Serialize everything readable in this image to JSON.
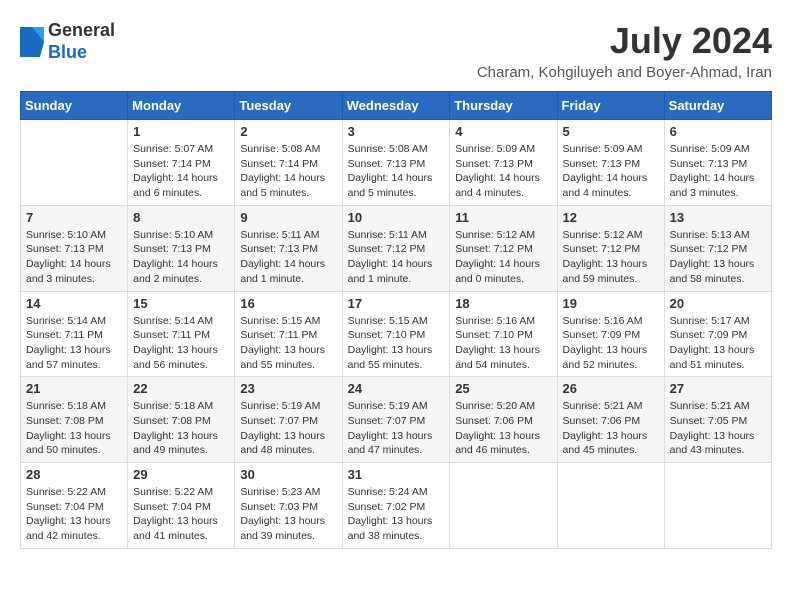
{
  "header": {
    "logo_general": "General",
    "logo_blue": "Blue",
    "month_title": "July 2024",
    "location": "Charam, Kohgiluyeh and Boyer-Ahmad, Iran"
  },
  "weekdays": [
    "Sunday",
    "Monday",
    "Tuesday",
    "Wednesday",
    "Thursday",
    "Friday",
    "Saturday"
  ],
  "weeks": [
    [
      {
        "day": "",
        "sunrise": "",
        "sunset": "",
        "daylight": ""
      },
      {
        "day": "1",
        "sunrise": "Sunrise: 5:07 AM",
        "sunset": "Sunset: 7:14 PM",
        "daylight": "Daylight: 14 hours and 6 minutes."
      },
      {
        "day": "2",
        "sunrise": "Sunrise: 5:08 AM",
        "sunset": "Sunset: 7:14 PM",
        "daylight": "Daylight: 14 hours and 5 minutes."
      },
      {
        "day": "3",
        "sunrise": "Sunrise: 5:08 AM",
        "sunset": "Sunset: 7:13 PM",
        "daylight": "Daylight: 14 hours and 5 minutes."
      },
      {
        "day": "4",
        "sunrise": "Sunrise: 5:09 AM",
        "sunset": "Sunset: 7:13 PM",
        "daylight": "Daylight: 14 hours and 4 minutes."
      },
      {
        "day": "5",
        "sunrise": "Sunrise: 5:09 AM",
        "sunset": "Sunset: 7:13 PM",
        "daylight": "Daylight: 14 hours and 4 minutes."
      },
      {
        "day": "6",
        "sunrise": "Sunrise: 5:09 AM",
        "sunset": "Sunset: 7:13 PM",
        "daylight": "Daylight: 14 hours and 3 minutes."
      }
    ],
    [
      {
        "day": "7",
        "sunrise": "Sunrise: 5:10 AM",
        "sunset": "Sunset: 7:13 PM",
        "daylight": "Daylight: 14 hours and 3 minutes."
      },
      {
        "day": "8",
        "sunrise": "Sunrise: 5:10 AM",
        "sunset": "Sunset: 7:13 PM",
        "daylight": "Daylight: 14 hours and 2 minutes."
      },
      {
        "day": "9",
        "sunrise": "Sunrise: 5:11 AM",
        "sunset": "Sunset: 7:13 PM",
        "daylight": "Daylight: 14 hours and 1 minute."
      },
      {
        "day": "10",
        "sunrise": "Sunrise: 5:11 AM",
        "sunset": "Sunset: 7:12 PM",
        "daylight": "Daylight: 14 hours and 1 minute."
      },
      {
        "day": "11",
        "sunrise": "Sunrise: 5:12 AM",
        "sunset": "Sunset: 7:12 PM",
        "daylight": "Daylight: 14 hours and 0 minutes."
      },
      {
        "day": "12",
        "sunrise": "Sunrise: 5:12 AM",
        "sunset": "Sunset: 7:12 PM",
        "daylight": "Daylight: 13 hours and 59 minutes."
      },
      {
        "day": "13",
        "sunrise": "Sunrise: 5:13 AM",
        "sunset": "Sunset: 7:12 PM",
        "daylight": "Daylight: 13 hours and 58 minutes."
      }
    ],
    [
      {
        "day": "14",
        "sunrise": "Sunrise: 5:14 AM",
        "sunset": "Sunset: 7:11 PM",
        "daylight": "Daylight: 13 hours and 57 minutes."
      },
      {
        "day": "15",
        "sunrise": "Sunrise: 5:14 AM",
        "sunset": "Sunset: 7:11 PM",
        "daylight": "Daylight: 13 hours and 56 minutes."
      },
      {
        "day": "16",
        "sunrise": "Sunrise: 5:15 AM",
        "sunset": "Sunset: 7:11 PM",
        "daylight": "Daylight: 13 hours and 55 minutes."
      },
      {
        "day": "17",
        "sunrise": "Sunrise: 5:15 AM",
        "sunset": "Sunset: 7:10 PM",
        "daylight": "Daylight: 13 hours and 55 minutes."
      },
      {
        "day": "18",
        "sunrise": "Sunrise: 5:16 AM",
        "sunset": "Sunset: 7:10 PM",
        "daylight": "Daylight: 13 hours and 54 minutes."
      },
      {
        "day": "19",
        "sunrise": "Sunrise: 5:16 AM",
        "sunset": "Sunset: 7:09 PM",
        "daylight": "Daylight: 13 hours and 52 minutes."
      },
      {
        "day": "20",
        "sunrise": "Sunrise: 5:17 AM",
        "sunset": "Sunset: 7:09 PM",
        "daylight": "Daylight: 13 hours and 51 minutes."
      }
    ],
    [
      {
        "day": "21",
        "sunrise": "Sunrise: 5:18 AM",
        "sunset": "Sunset: 7:08 PM",
        "daylight": "Daylight: 13 hours and 50 minutes."
      },
      {
        "day": "22",
        "sunrise": "Sunrise: 5:18 AM",
        "sunset": "Sunset: 7:08 PM",
        "daylight": "Daylight: 13 hours and 49 minutes."
      },
      {
        "day": "23",
        "sunrise": "Sunrise: 5:19 AM",
        "sunset": "Sunset: 7:07 PM",
        "daylight": "Daylight: 13 hours and 48 minutes."
      },
      {
        "day": "24",
        "sunrise": "Sunrise: 5:19 AM",
        "sunset": "Sunset: 7:07 PM",
        "daylight": "Daylight: 13 hours and 47 minutes."
      },
      {
        "day": "25",
        "sunrise": "Sunrise: 5:20 AM",
        "sunset": "Sunset: 7:06 PM",
        "daylight": "Daylight: 13 hours and 46 minutes."
      },
      {
        "day": "26",
        "sunrise": "Sunrise: 5:21 AM",
        "sunset": "Sunset: 7:06 PM",
        "daylight": "Daylight: 13 hours and 45 minutes."
      },
      {
        "day": "27",
        "sunrise": "Sunrise: 5:21 AM",
        "sunset": "Sunset: 7:05 PM",
        "daylight": "Daylight: 13 hours and 43 minutes."
      }
    ],
    [
      {
        "day": "28",
        "sunrise": "Sunrise: 5:22 AM",
        "sunset": "Sunset: 7:04 PM",
        "daylight": "Daylight: 13 hours and 42 minutes."
      },
      {
        "day": "29",
        "sunrise": "Sunrise: 5:22 AM",
        "sunset": "Sunset: 7:04 PM",
        "daylight": "Daylight: 13 hours and 41 minutes."
      },
      {
        "day": "30",
        "sunrise": "Sunrise: 5:23 AM",
        "sunset": "Sunset: 7:03 PM",
        "daylight": "Daylight: 13 hours and 39 minutes."
      },
      {
        "day": "31",
        "sunrise": "Sunrise: 5:24 AM",
        "sunset": "Sunset: 7:02 PM",
        "daylight": "Daylight: 13 hours and 38 minutes."
      },
      {
        "day": "",
        "sunrise": "",
        "sunset": "",
        "daylight": ""
      },
      {
        "day": "",
        "sunrise": "",
        "sunset": "",
        "daylight": ""
      },
      {
        "day": "",
        "sunrise": "",
        "sunset": "",
        "daylight": ""
      }
    ]
  ]
}
